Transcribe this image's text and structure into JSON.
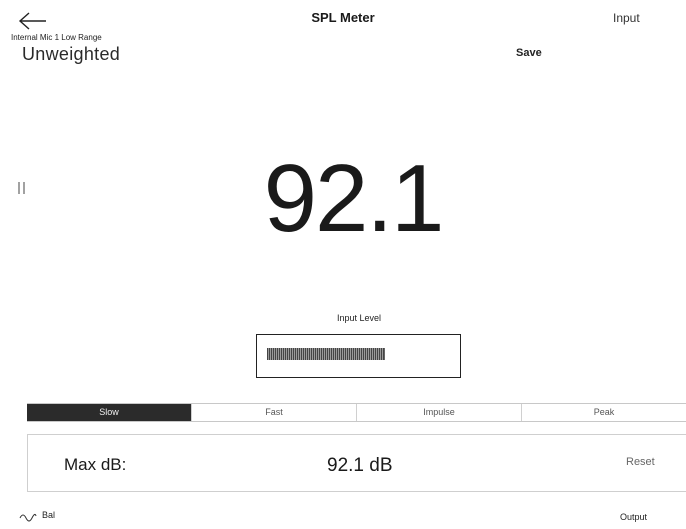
{
  "header": {
    "title": "SPL Meter",
    "back_icon": "arrow-left-icon",
    "input_label": "Input",
    "save_label": "Save"
  },
  "source": {
    "device_label": "Internal Mic 1 Low Range",
    "weighting": "Unweighted"
  },
  "meter": {
    "reading": "92.1",
    "pause_icon": "pause-icon"
  },
  "input_level": {
    "label": "Input Level",
    "fill_fraction": 0.64,
    "peak_fraction": 0.64
  },
  "response_modes": {
    "options": [
      "Slow",
      "Fast",
      "Impulse",
      "Peak"
    ],
    "selected": "Slow"
  },
  "max": {
    "label": "Max dB:",
    "value": "92.1 dB",
    "reset_label": "Reset"
  },
  "footer": {
    "bal_icon": "sine-wave-icon",
    "bal_label": "Bal",
    "output_label": "Output"
  },
  "colors": {
    "background": "#ffffff",
    "text": "#1a1a1a",
    "active_segment": "#2b2b2b"
  }
}
